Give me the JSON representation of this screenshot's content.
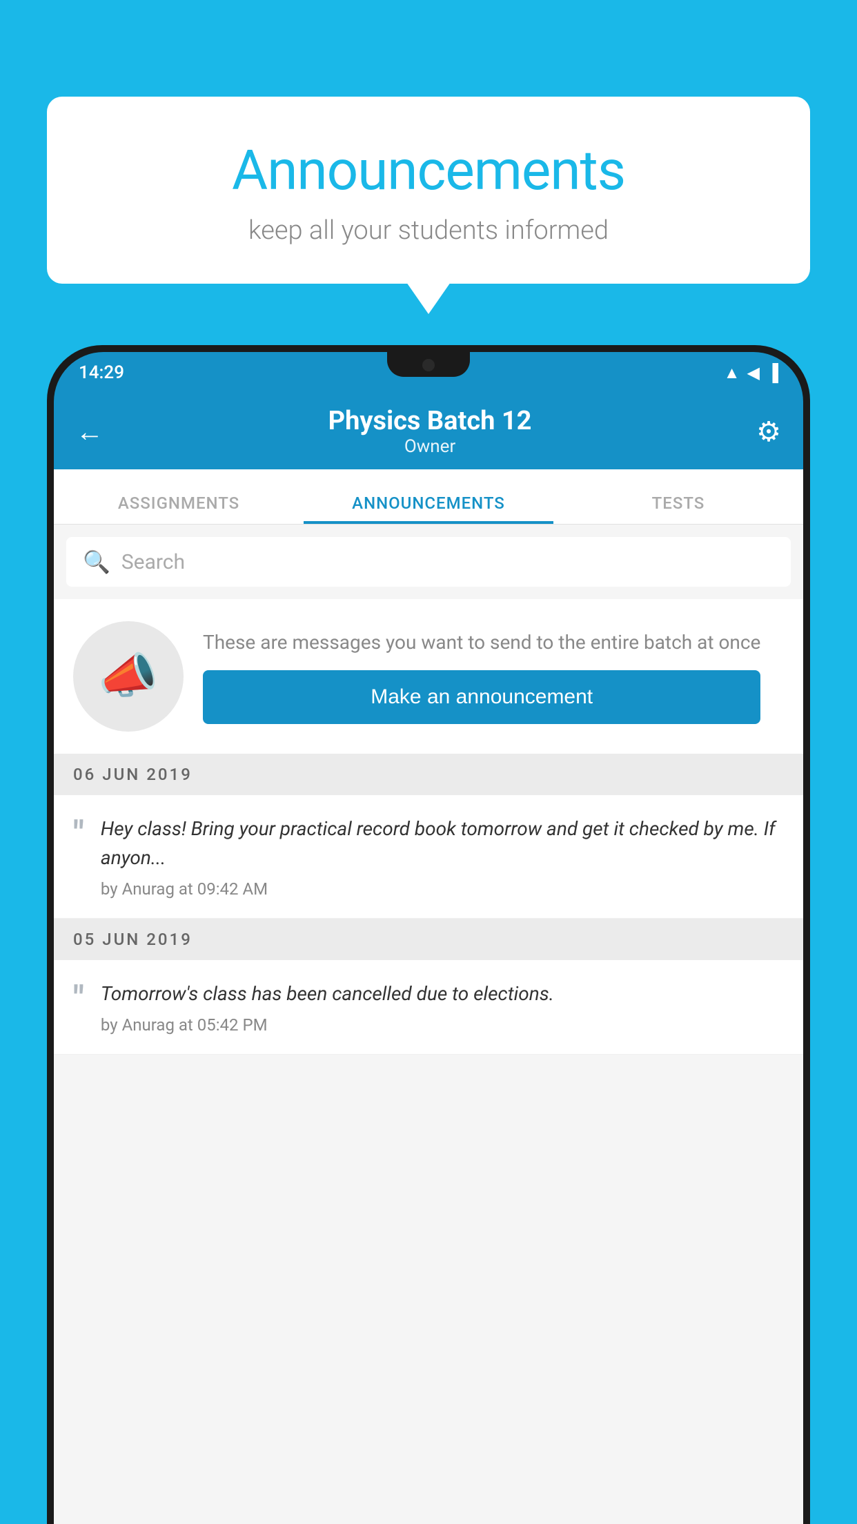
{
  "background_color": "#1ab8e8",
  "speech_bubble": {
    "title": "Announcements",
    "subtitle": "keep all your students informed"
  },
  "status_bar": {
    "time": "14:29",
    "wifi": "▲",
    "signal": "▲",
    "battery": "▮"
  },
  "app_header": {
    "back_label": "←",
    "title": "Physics Batch 12",
    "subtitle": "Owner",
    "settings_icon": "⚙"
  },
  "tabs": [
    {
      "label": "ASSIGNMENTS",
      "active": false
    },
    {
      "label": "ANNOUNCEMENTS",
      "active": true
    },
    {
      "label": "TESTS",
      "active": false
    }
  ],
  "search": {
    "placeholder": "Search"
  },
  "promo": {
    "description": "These are messages you want to send to the entire batch at once",
    "button_label": "Make an announcement"
  },
  "announcements": [
    {
      "date": "06  JUN  2019",
      "message": "Hey class! Bring your practical record book tomorrow and get it checked by me. If anyon...",
      "by": "by Anurag at 09:42 AM"
    },
    {
      "date": "05  JUN  2019",
      "message": "Tomorrow's class has been cancelled due to elections.",
      "by": "by Anurag at 05:42 PM"
    }
  ]
}
